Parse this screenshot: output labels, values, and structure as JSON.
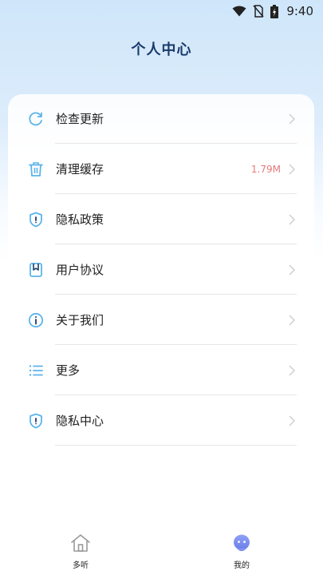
{
  "status_bar": {
    "time": "9:40",
    "icons": [
      "wifi-icon",
      "no-sim-icon",
      "battery-charging-icon"
    ]
  },
  "header": {
    "title": "个人中心"
  },
  "menu": {
    "items": [
      {
        "label": "检查更新",
        "icon": "refresh-icon",
        "value": ""
      },
      {
        "label": "清理缓存",
        "icon": "trash-icon",
        "value": "1.79M"
      },
      {
        "label": "隐私政策",
        "icon": "shield-icon",
        "value": ""
      },
      {
        "label": "用户协议",
        "icon": "bookmark-icon",
        "value": ""
      },
      {
        "label": "关于我们",
        "icon": "info-icon",
        "value": ""
      },
      {
        "label": "更多",
        "icon": "list-icon",
        "value": ""
      },
      {
        "label": "隐私中心",
        "icon": "shield-icon",
        "value": ""
      }
    ]
  },
  "colors": {
    "accent": "#5bb4ea",
    "cache_value": "#e8787a",
    "title": "#1a3a6b",
    "nav_active": "#7b8cf2"
  },
  "bottom_nav": {
    "items": [
      {
        "label": "多听",
        "icon": "home-icon",
        "active": false
      },
      {
        "label": "我的",
        "icon": "profile-icon",
        "active": true
      }
    ]
  }
}
